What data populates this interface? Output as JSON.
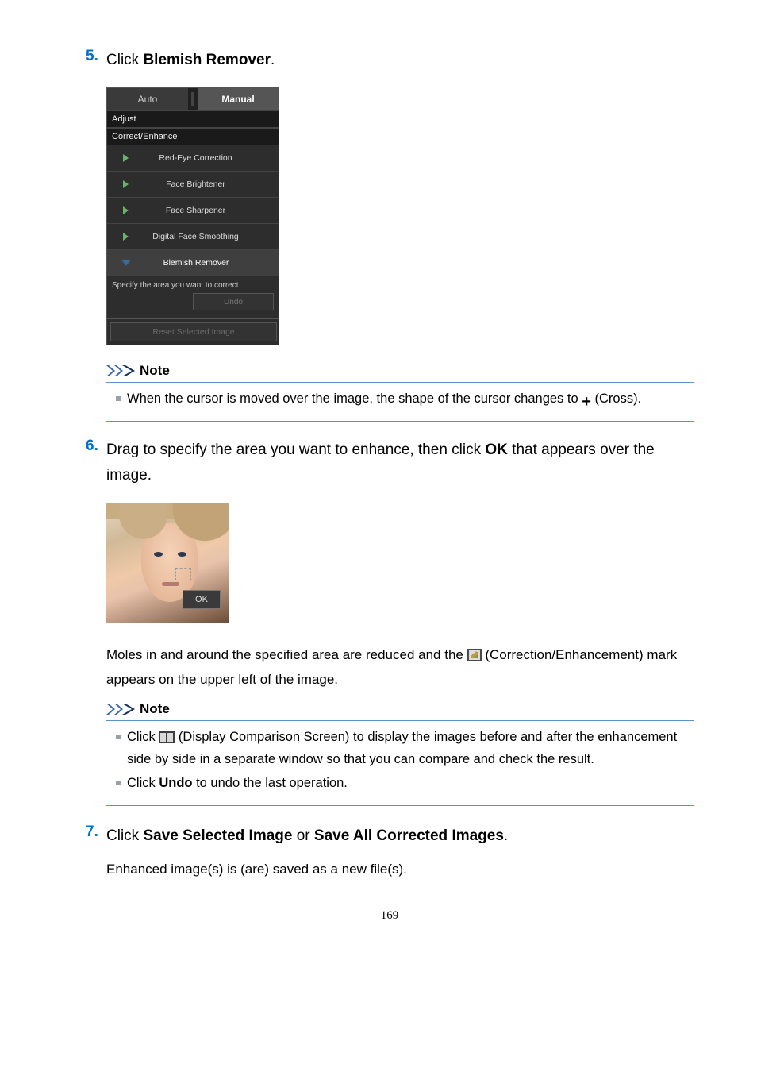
{
  "steps": {
    "s5": {
      "num": "5.",
      "pre": "Click ",
      "bold": "Blemish Remover",
      "post": "."
    },
    "s6": {
      "num": "6.",
      "pre": "Drag to specify the area you want to enhance, then click ",
      "bold": "OK",
      "post": " that appears over the image."
    },
    "s7": {
      "num": "7.",
      "pre": "Click ",
      "bold1": "Save Selected Image",
      "mid": " or ",
      "bold2": "Save All Corrected Images",
      "post": "."
    }
  },
  "panel": {
    "tabAuto": "Auto",
    "tabManual": "Manual",
    "adjust": "Adjust",
    "correct": "Correct/Enhance",
    "tools": {
      "redeye": "Red-Eye Correction",
      "brightener": "Face Brightener",
      "sharpener": "Face Sharpener",
      "smoothing": "Digital Face Smoothing",
      "blemish": "Blemish Remover"
    },
    "specify": "Specify the area you want to correct",
    "undo": "Undo",
    "reset": "Reset Selected Image"
  },
  "note1": {
    "title": "Note",
    "item1a": "When the cursor is moved over the image, the shape of the cursor changes to ",
    "item1b": " (Cross).",
    "plus": "+"
  },
  "face": {
    "ok": "OK"
  },
  "after6": {
    "line1a": "Moles in and around the specified area are reduced and the ",
    "line1b": " (Correction/Enhancement) mark appears on the upper left of the image."
  },
  "note2": {
    "title": "Note",
    "item1a": "Click ",
    "item1b": " (Display Comparison Screen) to display the images before and after the enhancement side by side in a separate window so that you can compare and check the result.",
    "item2a": "Click ",
    "item2bold": "Undo",
    "item2b": " to undo the last operation."
  },
  "after7": "Enhanced image(s) is (are) saved as a new file(s).",
  "pageNum": "169"
}
